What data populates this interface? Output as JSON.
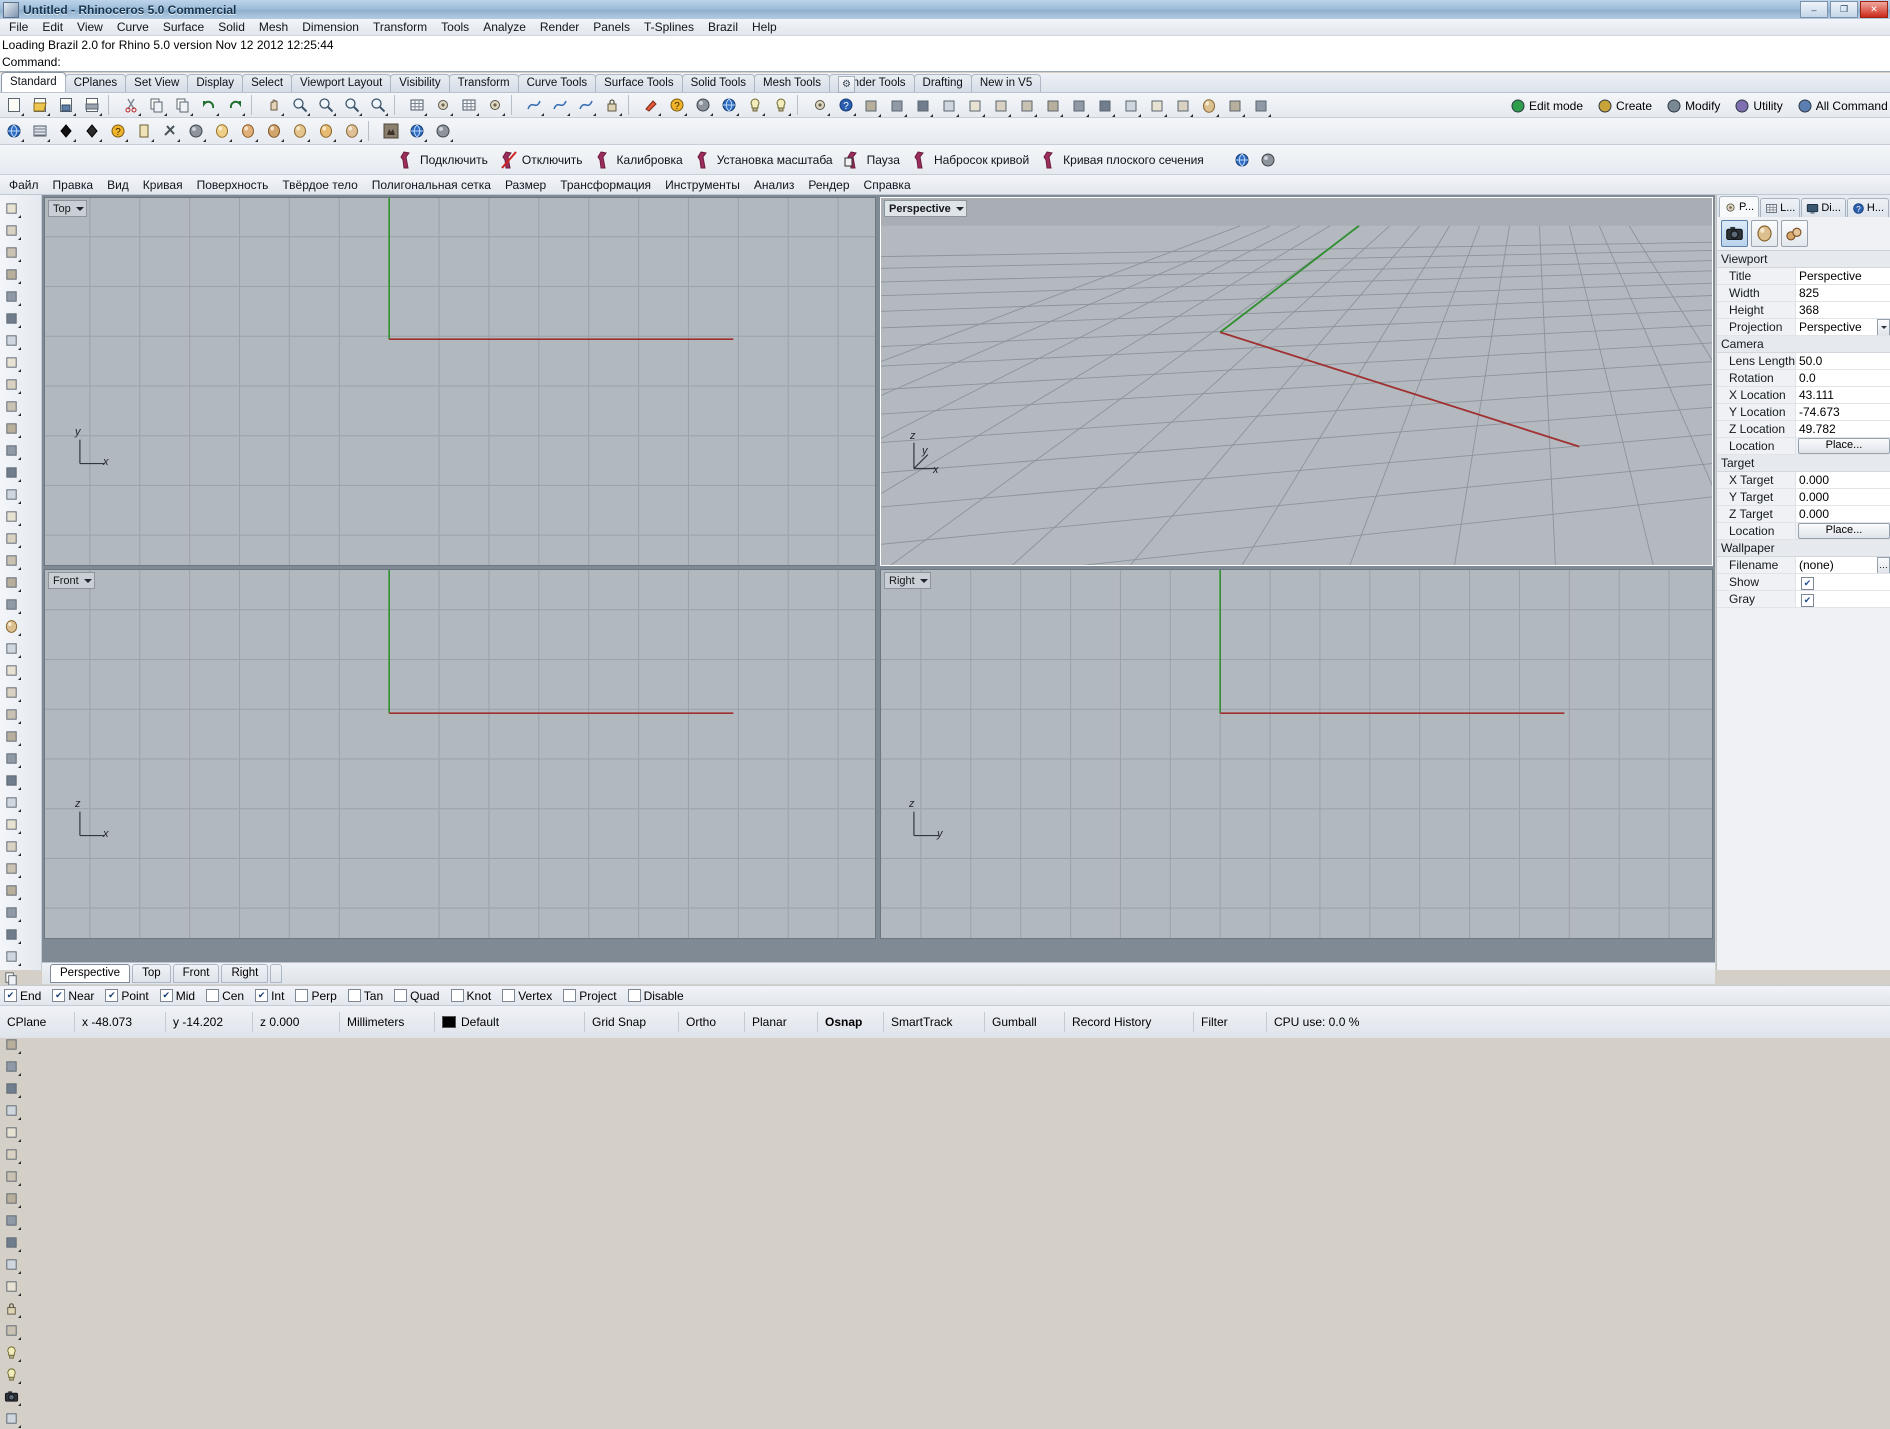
{
  "window": {
    "title": "Untitled - Rhinoceros 5.0 Commercial",
    "icon": "rhino-icon",
    "minimize": "–",
    "maximize": "❐",
    "close": "✕"
  },
  "menubar": {
    "items": [
      "File",
      "Edit",
      "View",
      "Curve",
      "Surface",
      "Solid",
      "Mesh",
      "Dimension",
      "Transform",
      "Tools",
      "Analyze",
      "Render",
      "Panels",
      "T-Splines",
      "Brazil",
      "Help"
    ]
  },
  "command": {
    "history": "Loading Brazil 2.0 for Rhino 5.0 version Nov 12 2012 12:25:44",
    "prompt": "Command:"
  },
  "toolbar_tabs": {
    "items": [
      "Standard",
      "CPlanes",
      "Set View",
      "Display",
      "Select",
      "Viewport Layout",
      "Visibility",
      "Transform",
      "Curve Tools",
      "Surface Tools",
      "Solid Tools",
      "Mesh Tools",
      "Render Tools",
      "Drafting",
      "New in V5"
    ],
    "selected": "Standard",
    "options_icon": "gear-icon"
  },
  "standard_toolbar": {
    "icons": [
      "new-file-icon",
      "open-file-icon",
      "save-icon",
      "print-icon",
      "cut-icon",
      "copy-icon",
      "paste-icon",
      "undo-icon",
      "redo-icon",
      "pan-icon",
      "zoom-window-icon",
      "zoom-extents-icon",
      "zoom-selected-icon",
      "zoom-dynamic-icon",
      "grid-snap-icon",
      "object-snap-icon",
      "layers-icon",
      "properties-icon",
      "curve-tools-icon",
      "surface-tools-icon",
      "solid-tools-icon",
      "lock-icon",
      "paint-icon",
      "render-color-icon",
      "shade-icon",
      "render-icon",
      "light-icon",
      "flashlight-icon",
      "options-icon",
      "help-icon"
    ]
  },
  "render_toolbar": {
    "icons": [
      "brazil-render-icon",
      "render-queue-icon",
      "material-black-icon",
      "material-dark-icon",
      "material-help-icon",
      "material-card-icon",
      "material-tools-icon",
      "material-metal-icon",
      "sphere-gold-icon",
      "sphere-copper-icon",
      "sphere-bronze-icon",
      "sphere-wood-icon",
      "sphere-amber-icon",
      "sphere-tan-icon",
      "wolf-avatar-icon",
      "globe-icon",
      "sphere-grey-icon"
    ]
  },
  "plugin_toolbar": {
    "buttons": [
      {
        "label": "Подключить",
        "icon": "connect-icon"
      },
      {
        "label": "Отключить",
        "icon": "disconnect-icon"
      },
      {
        "label": "Калибровка",
        "icon": "calibrate-icon"
      },
      {
        "label": "Установка масштаба",
        "icon": "set-scale-icon"
      },
      {
        "label": "Пауза",
        "icon": "pause-icon"
      },
      {
        "label": "Набросок кривой",
        "icon": "sketch-curve-icon"
      },
      {
        "label": "Кривая плоского сечения",
        "icon": "section-curve-icon"
      }
    ]
  },
  "plugin_menu": {
    "items": [
      "Файл",
      "Правка",
      "Вид",
      "Кривая",
      "Поверхность",
      "Твёрдое тело",
      "Полигональная сетка",
      "Размер",
      "Трансформация",
      "Инструменты",
      "Анализ",
      "Рендер",
      "Справка"
    ]
  },
  "viewports": {
    "items": [
      {
        "name": "top",
        "title": "Top",
        "active": false,
        "axis_x": "x",
        "axis_y": "y"
      },
      {
        "name": "perspective",
        "title": "Perspective",
        "active": true,
        "axis_x": "x",
        "axis_y": "y",
        "axis_z": "z"
      },
      {
        "name": "front",
        "title": "Front",
        "active": false,
        "axis_x": "x",
        "axis_y": "z"
      },
      {
        "name": "right",
        "title": "Right",
        "active": false,
        "axis_x": "y",
        "axis_y": "z"
      }
    ],
    "tabs": [
      "Perspective",
      "Top",
      "Front",
      "Right"
    ],
    "selected_tab": "Perspective",
    "add_tab": "+"
  },
  "right_panel": {
    "tabs": [
      {
        "label": "P...",
        "icon": "properties-icon",
        "selected": true
      },
      {
        "label": "L...",
        "icon": "layers-icon",
        "selected": false
      },
      {
        "label": "Di...",
        "icon": "display-icon",
        "selected": false
      },
      {
        "label": "H...",
        "icon": "help-icon",
        "selected": false
      }
    ],
    "subtabs": [
      {
        "icon": "camera-icon",
        "selected": true
      },
      {
        "icon": "material-sphere-icon",
        "selected": false
      },
      {
        "icon": "render-beads-icon",
        "selected": false
      }
    ],
    "sections": [
      {
        "title": "Viewport",
        "rows": [
          {
            "label": "Title",
            "value": "Perspective",
            "type": "text"
          },
          {
            "label": "Width",
            "value": "825",
            "type": "text"
          },
          {
            "label": "Height",
            "value": "368",
            "type": "text"
          },
          {
            "label": "Projection",
            "value": "Perspective",
            "type": "combo"
          }
        ]
      },
      {
        "title": "Camera",
        "rows": [
          {
            "label": "Lens Length",
            "value": "50.0",
            "type": "text"
          },
          {
            "label": "Rotation",
            "value": "0.0",
            "type": "text"
          },
          {
            "label": "X Location",
            "value": "43.111",
            "type": "text"
          },
          {
            "label": "Y Location",
            "value": "-74.673",
            "type": "text"
          },
          {
            "label": "Z Location",
            "value": "49.782",
            "type": "text"
          },
          {
            "label": "Location",
            "value": "Place...",
            "type": "button"
          }
        ]
      },
      {
        "title": "Target",
        "rows": [
          {
            "label": "X Target",
            "value": "0.000",
            "type": "text"
          },
          {
            "label": "Y Target",
            "value": "0.000",
            "type": "text"
          },
          {
            "label": "Z Target",
            "value": "0.000",
            "type": "text"
          },
          {
            "label": "Location",
            "value": "Place...",
            "type": "button"
          }
        ]
      },
      {
        "title": "Wallpaper",
        "rows": [
          {
            "label": "Filename",
            "value": "(none)",
            "type": "file"
          },
          {
            "label": "Show",
            "value": "✔",
            "type": "check"
          },
          {
            "label": "Gray",
            "value": "✔",
            "type": "check"
          }
        ]
      }
    ]
  },
  "osnap": {
    "items": [
      {
        "label": "End",
        "checked": true
      },
      {
        "label": "Near",
        "checked": true
      },
      {
        "label": "Point",
        "checked": true
      },
      {
        "label": "Mid",
        "checked": true
      },
      {
        "label": "Cen",
        "checked": false
      },
      {
        "label": "Int",
        "checked": true
      },
      {
        "label": "Perp",
        "checked": false
      },
      {
        "label": "Tan",
        "checked": false
      },
      {
        "label": "Quad",
        "checked": false
      },
      {
        "label": "Knot",
        "checked": false
      },
      {
        "label": "Vertex",
        "checked": false
      },
      {
        "label": "Project",
        "checked": false
      },
      {
        "label": "Disable",
        "checked": false
      }
    ]
  },
  "statusbar": {
    "cplane": "CPlane",
    "x": "x -48.073",
    "y": "y -14.202",
    "z": "z 0.000",
    "units": "Millimeters",
    "layer": "Default",
    "layer_color": "#000000",
    "toggles": [
      "Grid Snap",
      "Ortho",
      "Planar",
      "Osnap",
      "SmartTrack",
      "Gumball",
      "Record History",
      "Filter"
    ],
    "active_toggle": "Osnap",
    "cpu": "CPU use: 0.0 %"
  },
  "colors": {
    "viewport_bg": "#b1b8be",
    "perspective_bg": "#a8aeb4",
    "grid_line": "#8a9199",
    "grid_major": "#71787f",
    "axis_x": "#a03030",
    "axis_y": "#2f8f2f",
    "title_accent": "#153450"
  }
}
